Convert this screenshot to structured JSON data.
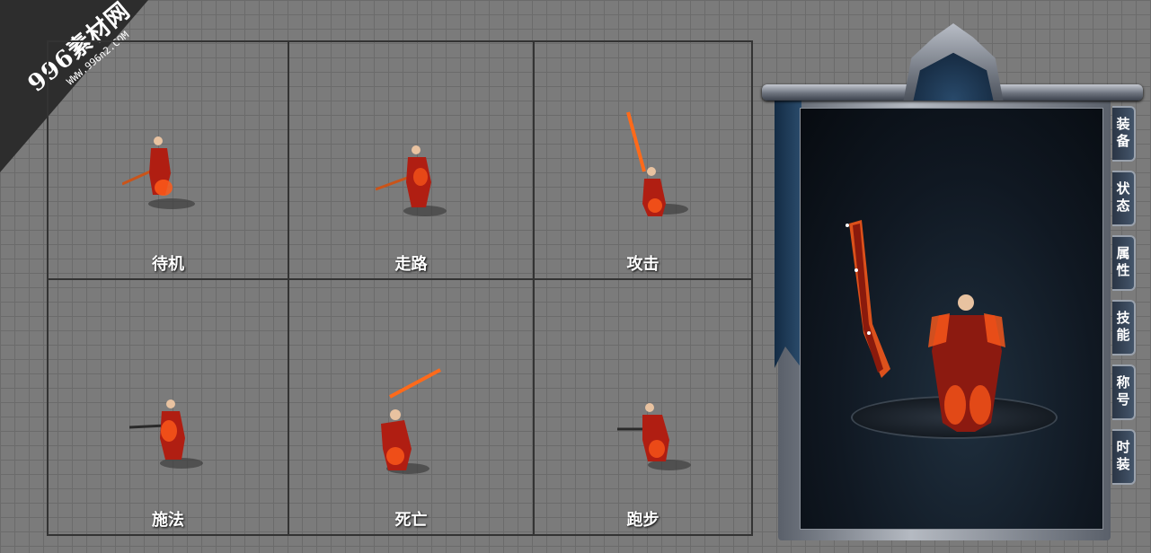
{
  "watermark": {
    "main": "996素材网",
    "sub": "WWW.996n2.COM"
  },
  "cells": [
    {
      "label": "待机"
    },
    {
      "label": "走路"
    },
    {
      "label": "攻击"
    },
    {
      "label": "施法"
    },
    {
      "label": "死亡"
    },
    {
      "label": "跑步"
    }
  ],
  "panel": {
    "tabs": [
      "装备",
      "状态",
      "属性",
      "技能",
      "称号",
      "时装"
    ]
  },
  "colors": {
    "background": "#7b7b7b",
    "grid_line": "#6b6b6b",
    "cell_border": "#333333",
    "flame": "#ff5a1a",
    "armor_red": "#b01e12",
    "panel_dark": "#0d1c2e"
  }
}
